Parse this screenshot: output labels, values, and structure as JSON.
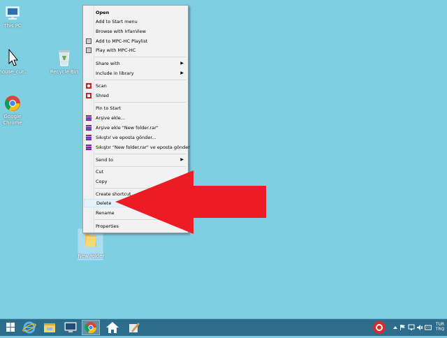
{
  "desktop": {
    "icons": [
      {
        "label": "This PC"
      },
      {
        "label": "mouse_cur..."
      },
      {
        "label": "Recycle Bin"
      },
      {
        "label": "Google Chrome"
      },
      {
        "label": "New folder"
      }
    ]
  },
  "context_menu": {
    "items": [
      {
        "label": "Open",
        "bold": true
      },
      {
        "label": "Add to Start menu"
      },
      {
        "label": "Browse with IrfanView"
      },
      {
        "label": "Add to MPC-HC Playlist"
      },
      {
        "label": "Play with MPC-HC"
      },
      {
        "label": "Share with",
        "submenu": true
      },
      {
        "label": "Include in library",
        "submenu": true
      },
      {
        "label": "Scan"
      },
      {
        "label": "Shred"
      },
      {
        "label": "Pin to Start"
      },
      {
        "label": "Arşive ekle..."
      },
      {
        "label": "Arşive ekle \"New folder.rar\""
      },
      {
        "label": "Sıkıştır ve eposta gönder..."
      },
      {
        "label": "Sıkıştır \"New folder.rar\" ve eposta gönder"
      },
      {
        "label": "Send to",
        "submenu": true
      },
      {
        "label": "Cut"
      },
      {
        "label": "Copy"
      },
      {
        "label": "Create shortcut"
      },
      {
        "label": "Delete",
        "highlighted": true
      },
      {
        "label": "Rename"
      },
      {
        "label": "Properties"
      }
    ]
  },
  "taskbar": {
    "tray": {
      "language": "TUR",
      "language_sub": "TRQ"
    }
  },
  "colors": {
    "desktop_bg": "#7fcfe2",
    "taskbar_bg": "#2b6d8a",
    "arrow": "#ed1c24",
    "highlight": "#e5f1fb"
  },
  "icons": [
    "computer-icon",
    "mouse-cursor-icon",
    "recycle-bin-icon",
    "chrome-icon",
    "folder-icon",
    "start-icon",
    "ie-icon",
    "file-explorer-icon",
    "desktop-icon",
    "chrome-taskbar-icon",
    "home-icon",
    "paint-icon",
    "antivirus-tray-icon"
  ]
}
